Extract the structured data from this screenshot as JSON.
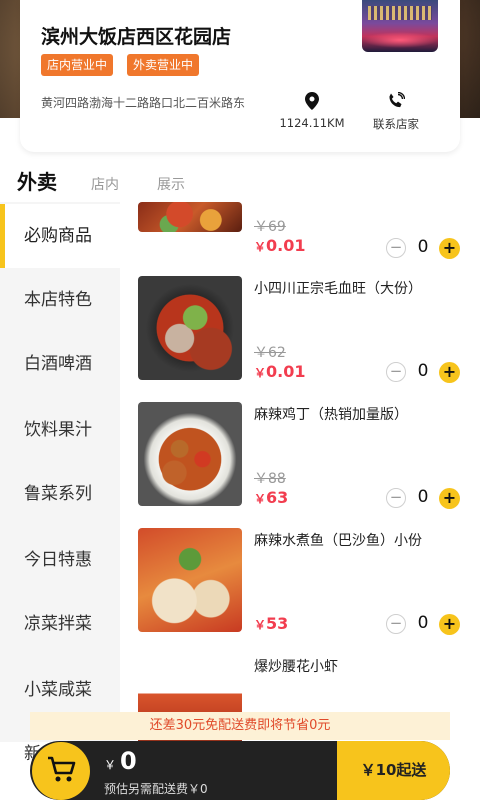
{
  "store": {
    "name": "滨州大饭店西区花园店",
    "badges": [
      "店内营业中",
      "外卖营业中"
    ],
    "address": "黄河四路渤海十二路路口北二百米路东",
    "distance": "1124.11KM",
    "contact_label": "联系店家"
  },
  "tabs": [
    {
      "label": "外卖",
      "active": true
    },
    {
      "label": "店内",
      "active": false
    },
    {
      "label": "展示",
      "active": false
    }
  ],
  "categories": [
    {
      "label": "必购商品",
      "active": true
    },
    {
      "label": "本店特色"
    },
    {
      "label": "白酒啤酒"
    },
    {
      "label": "饮料果汁"
    },
    {
      "label": "鲁菜系列"
    },
    {
      "label": "今日特惠"
    },
    {
      "label": "凉菜拌菜"
    },
    {
      "label": "小菜咸菜"
    },
    {
      "label": "新"
    }
  ],
  "products": [
    {
      "name": "",
      "orig_price": "￥69",
      "currency": "￥",
      "price": "0.01",
      "qty": "0"
    },
    {
      "name": "小四川正宗毛血旺（大份）",
      "orig_price": "￥62",
      "currency": "￥",
      "price": "0.01",
      "qty": "0"
    },
    {
      "name": "麻辣鸡丁（热销加量版）",
      "orig_price": "￥88",
      "currency": "￥",
      "price": "63",
      "qty": "0"
    },
    {
      "name": "麻辣水煮鱼（巴沙鱼）小份",
      "orig_price": "",
      "currency": "￥",
      "price": "53",
      "qty": "0"
    },
    {
      "name": "爆炒腰花小虾",
      "orig_price": "",
      "currency": "",
      "price": "",
      "qty": ""
    }
  ],
  "stepper": {
    "minus": "−",
    "plus": "+"
  },
  "delivery_notice": "还差30元免配送费即将节省0元",
  "cart": {
    "currency": "￥",
    "total": "0",
    "delivery_fee_text": "预估另需配送费￥0",
    "submit_label": "￥10起送"
  },
  "colors": {
    "accent_yellow": "#f7c41c",
    "badge_orange": "#f0772c",
    "price_red": "#f23d4f",
    "notice_bg": "#fdf1d6"
  }
}
